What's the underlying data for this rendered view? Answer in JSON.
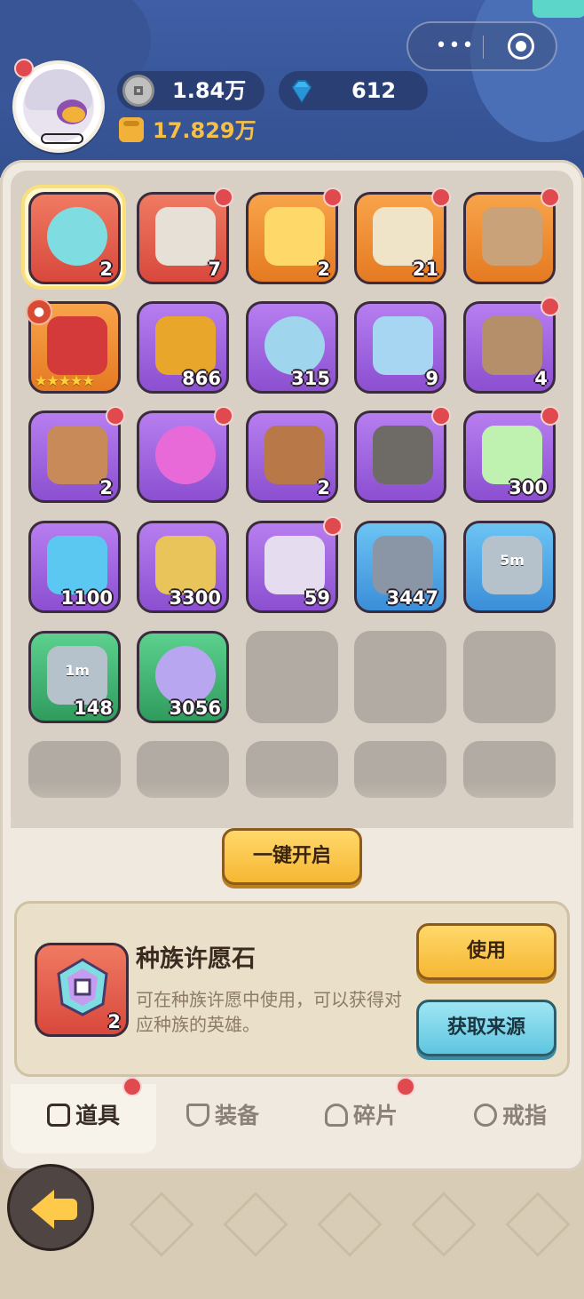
{
  "header": {
    "coins": "1.84万",
    "gems": "612",
    "power": "17.829万",
    "menu_dots": "•••"
  },
  "grid": {
    "items": [
      {
        "name": "race-wish-stone",
        "count": "2",
        "rarity": "red",
        "selected": true,
        "badge": false
      },
      {
        "name": "red-chest",
        "count": "7",
        "rarity": "red",
        "badge": true
      },
      {
        "name": "orange-ticket",
        "count": "2",
        "rarity": "orange",
        "badge": true
      },
      {
        "name": "gold-chest",
        "count": "21",
        "rarity": "orange",
        "badge": true
      },
      {
        "name": "supply-crate",
        "count": "",
        "rarity": "orange",
        "badge": true
      },
      {
        "name": "red-helmet-5star",
        "count": "",
        "rarity": "orange",
        "badge": false,
        "stars": "★★★★★"
      },
      {
        "name": "gold-ore",
        "count": "866",
        "rarity": "purple",
        "badge": false
      },
      {
        "name": "blue-crystal",
        "count": "315",
        "rarity": "purple",
        "badge": false
      },
      {
        "name": "blue-ticket",
        "count": "9",
        "rarity": "purple",
        "badge": false
      },
      {
        "name": "coin-bag",
        "count": "4",
        "rarity": "purple",
        "badge": true
      },
      {
        "name": "meat",
        "count": "2",
        "rarity": "purple",
        "badge": true
      },
      {
        "name": "pink-star-gem",
        "count": "",
        "rarity": "purple",
        "badge": true
      },
      {
        "name": "wood-logs",
        "count": "2",
        "rarity": "purple",
        "badge": false
      },
      {
        "name": "iron-ore-cart",
        "count": "",
        "rarity": "purple",
        "badge": true
      },
      {
        "name": "green-emblem",
        "count": "300",
        "rarity": "purple",
        "badge": true
      },
      {
        "name": "water-orb",
        "count": "1100",
        "rarity": "purple",
        "badge": false
      },
      {
        "name": "gold-medal",
        "count": "3300",
        "rarity": "purple",
        "badge": false
      },
      {
        "name": "purple-chest",
        "count": "59",
        "rarity": "purple",
        "badge": true
      },
      {
        "name": "rune-stone",
        "count": "3447",
        "rarity": "blue",
        "badge": false
      },
      {
        "name": "speedup-5m",
        "count": "",
        "rarity": "blue",
        "badge": false,
        "timer": "5m"
      },
      {
        "name": "speedup-1m",
        "count": "148",
        "rarity": "green",
        "badge": false,
        "timer": "1m"
      },
      {
        "name": "crystal-cluster",
        "count": "3056",
        "rarity": "green",
        "badge": false
      }
    ]
  },
  "actions": {
    "open_all": "一键开启",
    "use": "使用",
    "source": "获取来源"
  },
  "detail": {
    "name": "种族许愿石",
    "desc": "可在种族许愿中使用，可以获得对应种族的英雄。",
    "count": "2"
  },
  "tabs": [
    {
      "label": "道具",
      "active": true
    },
    {
      "label": "装备",
      "active": false
    },
    {
      "label": "碎片",
      "active": false
    },
    {
      "label": "戒指",
      "active": false
    }
  ],
  "colors": {
    "accent_yellow": "#f6b733",
    "accent_blue": "#5fc5e0",
    "badge_red": "#e04a4f"
  }
}
